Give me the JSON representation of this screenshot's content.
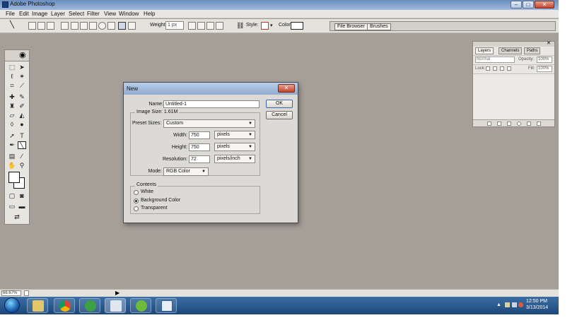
{
  "window": {
    "title": "Adobe Photoshop"
  },
  "menu": [
    "File",
    "Edit",
    "Image",
    "Layer",
    "Select",
    "Filter",
    "View",
    "Window",
    "Help"
  ],
  "options": {
    "weight_label": "Weight:",
    "weight_value": "1 px",
    "style_label": "Style:",
    "color_label": "Color:"
  },
  "palette_well": {
    "tabs": [
      "File Browser",
      "Brushes"
    ]
  },
  "dialog": {
    "title": "New",
    "name_label": "Name:",
    "name_value": "Untitled-1",
    "image_size": "Image Size: 1.61M",
    "preset_label": "Preset Sizes:",
    "preset_value": "Custom",
    "width_label": "Width:",
    "width_value": "750",
    "width_unit": "pixels",
    "height_label": "Height:",
    "height_value": "750",
    "height_unit": "pixels",
    "resolution_label": "Resolution:",
    "resolution_value": "72",
    "resolution_unit": "pixels/inch",
    "mode_label": "Mode:",
    "mode_value": "RGB Color",
    "ok": "OK",
    "cancel": "Cancel",
    "contents_label": "Contents",
    "contents_options": [
      "White",
      "Background Color",
      "Transparent"
    ],
    "contents_selected": "Background Color"
  },
  "layers_panel": {
    "tabs": [
      "Layers",
      "Channels",
      "Paths"
    ],
    "blend_mode": "Normal",
    "opacity_label": "Opacity:",
    "opacity_value": "100%",
    "lock_label": "Lock:",
    "fill_label": "Fill:",
    "fill_value": "100%"
  },
  "statusbar": {
    "zoom": "66.67%"
  },
  "taskbar": {
    "time": "12:50 PM",
    "date": "3/13/2014"
  },
  "colors": {
    "workspace": "#a59f98",
    "taskbar": "#1d4779"
  }
}
